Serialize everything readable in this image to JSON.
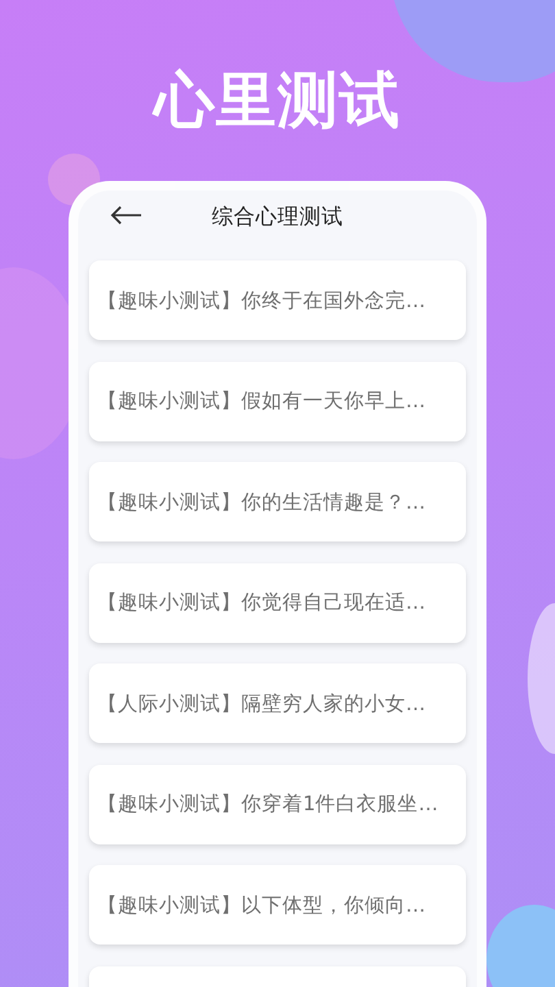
{
  "headline": "心里测试",
  "screen": {
    "title": "综合心理测试",
    "tests": [
      {
        "text": "【趣味小测试】你终于在国外念完…"
      },
      {
        "text": "【趣味小测试】假如有一天你早上…"
      },
      {
        "text": "【趣味小测试】你的生活情趣是？…"
      },
      {
        "text": "【趣味小测试】你觉得自己现在适…"
      },
      {
        "text": "【人际小测试】隔壁穷人家的小女…"
      },
      {
        "text": "【趣味小测试】你穿着1件白衣服坐…"
      },
      {
        "text": "【趣味小测试】以下体型，你倾向…"
      }
    ]
  }
}
